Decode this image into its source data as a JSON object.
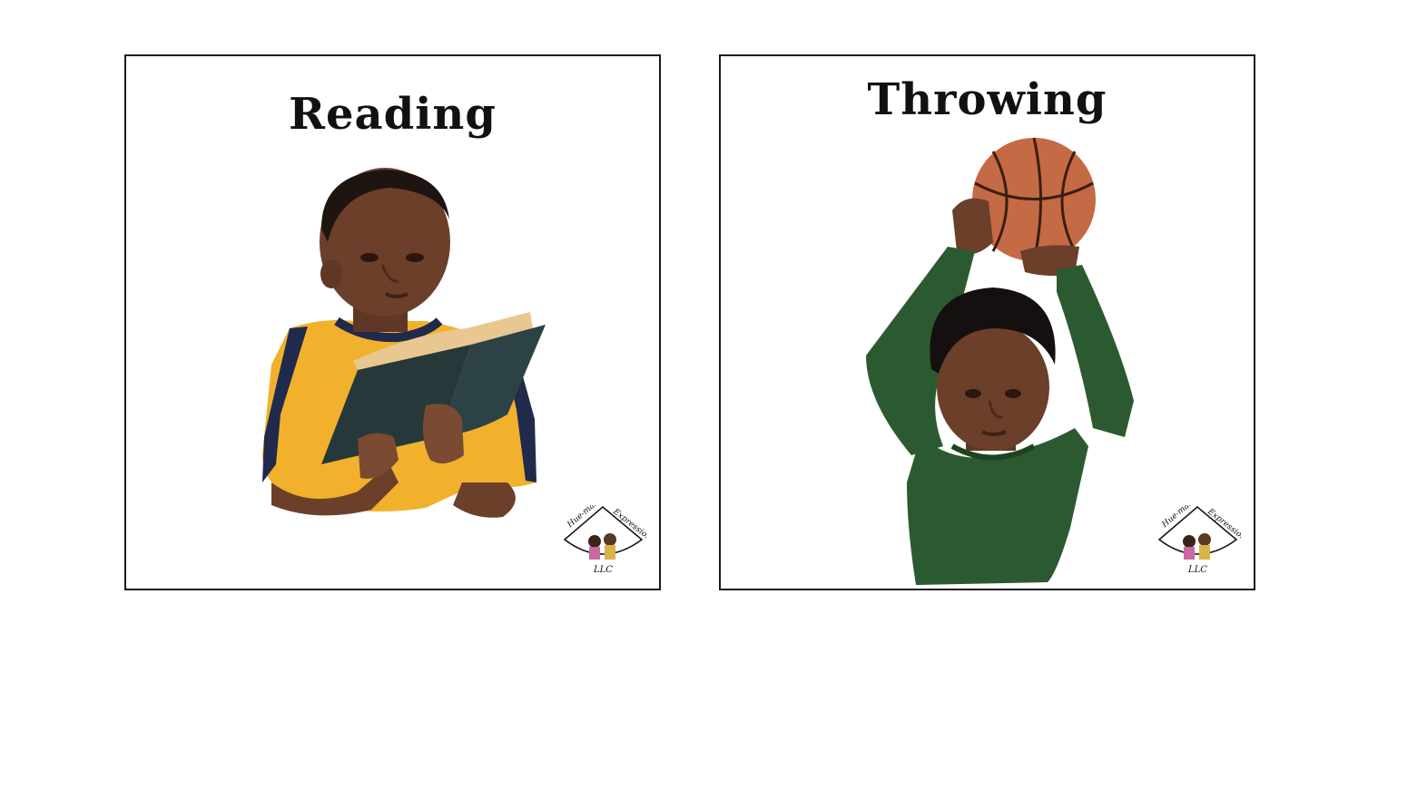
{
  "cards": [
    {
      "title": "Reading",
      "illustration": "child-reading-book",
      "colors": {
        "shirt": "#f2b12c",
        "shirt_trim": "#1f2a4d",
        "book": "#26383a",
        "skin": "#6b3f2a"
      }
    },
    {
      "title": "Throwing",
      "illustration": "child-throwing-basketball",
      "colors": {
        "shirt": "#2c5a30",
        "ball": "#c46a45",
        "skin": "#6b3f2a"
      }
    }
  ],
  "logo": {
    "top_left_text": "Hue-man",
    "top_right_text": "Expressions",
    "bottom_text": "LLC"
  }
}
